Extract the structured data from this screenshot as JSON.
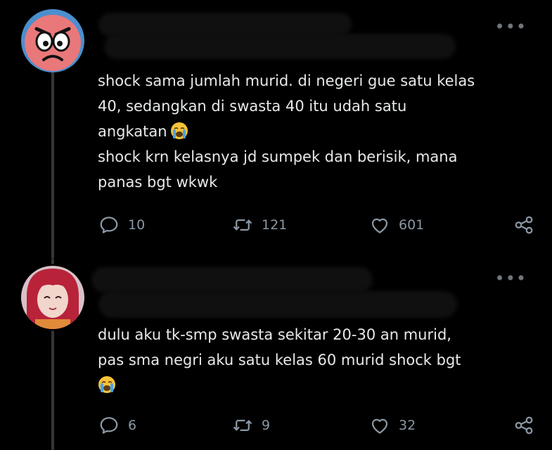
{
  "tweets": [
    {
      "menu_glyph": "•••",
      "avatar": "angry-face-avatar",
      "text_lines": [
        "shock sama jumlah murid. di negeri gue satu kelas",
        "40, sedangkan di swasta 40 itu udah satu",
        "angkatan",
        "shock krn kelasnya jd sumpek dan berisik, mana",
        "panas bgt wkwk"
      ],
      "emoji": "loudly-crying-face",
      "replies": "10",
      "retweets": "121",
      "likes": "601"
    },
    {
      "menu_glyph": "•••",
      "avatar": "red-haired-anime-avatar",
      "text_lines": [
        "dulu aku tk-smp swasta sekitar 20-30 an murid,",
        "pas sma negri aku satu kelas 60 murid shock bgt"
      ],
      "emoji": "loudly-crying-face",
      "replies": "6",
      "retweets": "9",
      "likes": "32"
    }
  ],
  "icons": {
    "reply": "reply-icon",
    "retweet": "retweet-icon",
    "like": "like-icon",
    "share": "share-icon",
    "more": "more-options-icon"
  },
  "colors": {
    "background": "#000000",
    "text": "#e7e9ea",
    "muted": "#8b98a5",
    "thread_line": "#333639"
  }
}
